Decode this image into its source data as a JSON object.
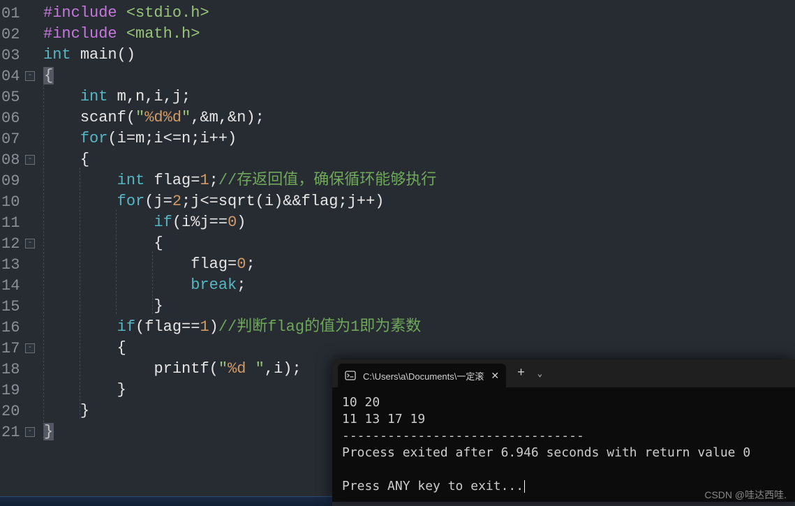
{
  "lines": [
    {
      "n": "01",
      "fold": null
    },
    {
      "n": "02",
      "fold": null
    },
    {
      "n": "03",
      "fold": null
    },
    {
      "n": "04",
      "fold": "-"
    },
    {
      "n": "05",
      "fold": null
    },
    {
      "n": "06",
      "fold": null
    },
    {
      "n": "07",
      "fold": null
    },
    {
      "n": "08",
      "fold": "-"
    },
    {
      "n": "09",
      "fold": null
    },
    {
      "n": "10",
      "fold": null
    },
    {
      "n": "11",
      "fold": null
    },
    {
      "n": "12",
      "fold": "-"
    },
    {
      "n": "13",
      "fold": null
    },
    {
      "n": "14",
      "fold": null
    },
    {
      "n": "15",
      "fold": null
    },
    {
      "n": "16",
      "fold": null
    },
    {
      "n": "17",
      "fold": "-"
    },
    {
      "n": "18",
      "fold": null
    },
    {
      "n": "19",
      "fold": null
    },
    {
      "n": "20",
      "fold": null
    },
    {
      "n": "21",
      "fold": "-"
    }
  ],
  "code": {
    "l1_pre": "#include ",
    "l1_inc": "<stdio.h>",
    "l2_pre": "#include ",
    "l2_inc": "<math.h>",
    "l3_type": "int ",
    "l3_main": "main",
    "l3_paren": "()",
    "l4_brace": "{",
    "l5_indent": "    ",
    "l5_type": "int ",
    "l5_vars": "m,n,i,j",
    "l6_indent": "    ",
    "l6_func": "scanf",
    "l6_open": "(",
    "l6_str_open": "\"",
    "l6_fmt": "%d%d",
    "l6_str_close": "\"",
    "l6_args": ",&m,&n",
    "l7_indent": "    ",
    "l7_for": "for",
    "l7_body": "(i=m;i<=n;i++)",
    "l8_indent": "    ",
    "l8_brace": "{",
    "l9_indent": "        ",
    "l9_type": "int ",
    "l9_var": "flag",
    "l9_eq": "=",
    "l9_num": "1",
    "l9_semi": ";",
    "l9_cmt": "//存返回值，确保循环能够执行",
    "l10_indent": "        ",
    "l10_for": "for",
    "l10_open": "(j=",
    "l10_num1": "2",
    "l10_mid": ";j<=",
    "l10_sqrt": "sqrt",
    "l10_args": "(i)&&flag;j++)",
    "l11_indent": "            ",
    "l11_if": "if",
    "l11_open": "(i%j==",
    "l11_num": "0",
    "l11_close": ")",
    "l12_indent": "            ",
    "l12_brace": "{",
    "l13_indent": "                ",
    "l13_var": "flag",
    "l13_eq": "=",
    "l13_num": "0",
    "l13_semi": ";",
    "l14_indent": "                ",
    "l14_break": "break",
    "l14_semi": ";",
    "l15_indent": "            ",
    "l15_brace": "}",
    "l16_indent": "        ",
    "l16_if": "if",
    "l16_open": "(flag==",
    "l16_num": "1",
    "l16_close": ")",
    "l16_cmt": "//判断flag的值为1即为素数",
    "l17_indent": "        ",
    "l17_brace": "{",
    "l18_indent": "            ",
    "l18_func": "printf",
    "l18_open": "(",
    "l18_str_open": "\"",
    "l18_fmt": "%d ",
    "l18_str_close": "\"",
    "l18_args": ",i",
    "l19_indent": "        ",
    "l19_brace": "}",
    "l20_indent": "    ",
    "l20_brace": "}",
    "l21_brace": "}"
  },
  "terminal": {
    "tab_title": "C:\\Users\\a\\Documents\\一定滚",
    "input_line": "10 20",
    "output_line": "11 13 17 19",
    "separator": "--------------------------------",
    "exit_line": "Process exited after 6.946 seconds with return value 0",
    "prompt_line": "Press ANY key to exit..."
  },
  "watermark": "CSDN @哇达西哇."
}
